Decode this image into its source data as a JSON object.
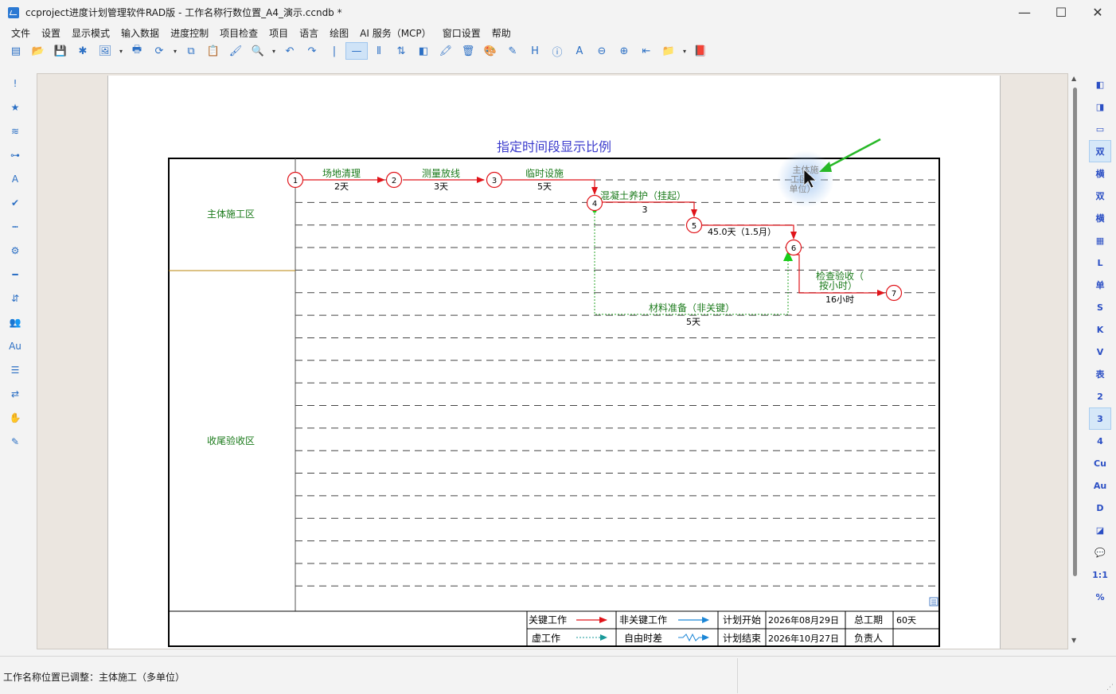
{
  "window": {
    "title": "ccproject进度计划管理软件RAD版 - 工作名称行数位置_A4_演示.ccndb *",
    "minimize": "—",
    "maximize": "☐",
    "close": "✕"
  },
  "menu": [
    "文件",
    "设置",
    "显示模式",
    "输入数据",
    "进度控制",
    "项目检查",
    "项目",
    "语言",
    "绘图",
    "AI 服务（MCP）",
    "窗口设置",
    "帮助"
  ],
  "toolbar_icons": [
    "new-icon",
    "open-icon",
    "save-icon",
    "snowflake-icon",
    "export-icon",
    "dropdown-icon",
    "print-icon",
    "refresh-icon",
    "dropdown-icon",
    "copy-icon",
    "paste-icon",
    "format-painter-icon",
    "search-icon",
    "dropdown-icon",
    "undo-icon",
    "redo-icon",
    "separator-icon",
    "line-mode-icon",
    "columns-icon",
    "sort-icon",
    "contrast-icon",
    "paint-icon",
    "delete-icon",
    "palette-icon",
    "edit-icon",
    "h-icon",
    "info-icon",
    "text-icon",
    "zoom-out-icon",
    "zoom-in-icon",
    "back-icon",
    "folder-open-icon",
    "dropdown-icon",
    "folder-icon"
  ],
  "toolbar_glyphs": [
    "▤",
    "📂",
    "💾",
    "✱",
    "🖼",
    "▾",
    "🖶",
    "⟳",
    "▾",
    "⧉",
    "📋",
    "🖌",
    "🔍",
    "▾",
    "↶",
    "↷",
    "|",
    "—",
    "⦀",
    "⇅",
    "◧",
    "🖍",
    "🗑",
    "🎨",
    "✎",
    "H",
    "ⓘ",
    "A",
    "⊖",
    "⊕",
    "⇤",
    "📁",
    "▾",
    "📕"
  ],
  "left_tools": [
    {
      "icon": "exclamation-icon",
      "glyph": "!"
    },
    {
      "icon": "star-icon",
      "glyph": "★"
    },
    {
      "icon": "wave-icon",
      "glyph": "≋"
    },
    {
      "icon": "key-icon",
      "glyph": "⊶"
    },
    {
      "icon": "font-icon",
      "glyph": "A"
    },
    {
      "icon": "check-icon",
      "glyph": "✔"
    },
    {
      "icon": "dotted-line-icon",
      "glyph": "┅"
    },
    {
      "icon": "gear-icon",
      "glyph": "⚙"
    },
    {
      "icon": "minus-icon",
      "glyph": "━"
    },
    {
      "icon": "sort-icon",
      "glyph": "⇵"
    },
    {
      "icon": "people-icon",
      "glyph": "👥"
    },
    {
      "icon": "au-icon",
      "glyph": "Au"
    },
    {
      "icon": "filter-icon",
      "glyph": "☰"
    },
    {
      "icon": "swap-icon",
      "glyph": "⇄"
    },
    {
      "icon": "hand-icon",
      "glyph": "✋"
    },
    {
      "icon": "pen-icon",
      "glyph": "✎"
    }
  ],
  "right_tools": [
    "◧",
    "◨",
    "▭",
    "双",
    "横",
    "双",
    "横",
    "▦",
    "L",
    "单",
    "S",
    "K",
    "V",
    "表",
    "2",
    "3",
    "4",
    "Cu",
    "Au",
    "D",
    "◪",
    "💬",
    "1:1",
    "%"
  ],
  "chart": {
    "title": "指定时间段显示比例",
    "zones": [
      "主体施工区",
      "收尾验收区"
    ],
    "nodes": [
      "1",
      "2",
      "3",
      "4",
      "5",
      "6",
      "7"
    ],
    "tasks": [
      {
        "name": "场地清理",
        "duration": "2天"
      },
      {
        "name": "测量放线",
        "duration": "3天"
      },
      {
        "name": "临时设施",
        "duration": "5天"
      },
      {
        "name": "混凝土养护（挂起）",
        "duration": "3"
      },
      {
        "name": "45.0天（1.5月）",
        "duration": ""
      },
      {
        "name_line1": "检查验收（",
        "name_line2": "按小时）",
        "duration": "16小时"
      },
      {
        "name": "材料准备（非关键）",
        "duration": "5天"
      }
    ],
    "floating_label": [
      "主体施",
      "工区",
      "单位）"
    ],
    "legend": {
      "critical": "关键工作",
      "noncritical": "非关键工作",
      "plan_start_label": "计划开始",
      "plan_start": "2026年08月29日",
      "total_label": "总工期",
      "total": "60天",
      "dummy": "虚工作",
      "free_float": "自由时差",
      "plan_end_label": "计划结束",
      "plan_end": "2026年10月27日",
      "owner_label": "负责人",
      "owner": ""
    },
    "colors": {
      "critical": "#e0141a",
      "noncritical": "#1c86d6",
      "dummy": "#2aa62a",
      "title": "#3a3acc",
      "zone": "#1a7a1a"
    }
  },
  "status": {
    "text": "工作名称位置已调整：主体施工（多单位）"
  }
}
